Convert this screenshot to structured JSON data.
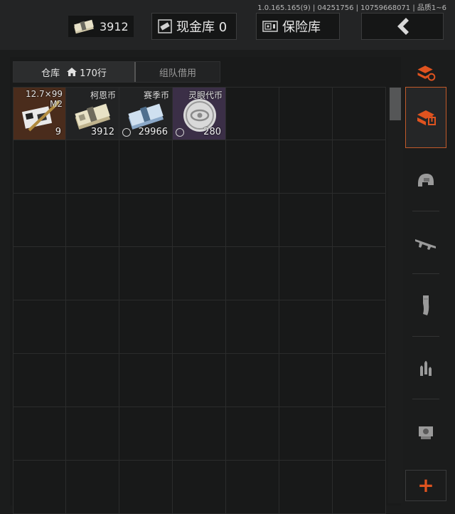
{
  "header": {
    "version": "1.0.165.165(9) | 04251756 | 10759668071 | 品质1~6",
    "money_value": "3912",
    "cash_button_label": "现金库 0",
    "safe_button_label": "保险库"
  },
  "tabs": {
    "warehouse_label": "仓库",
    "rows_label": "170行",
    "team_loan_label": "组队借用"
  },
  "inventory": {
    "items": [
      {
        "name": "12.7×99\nM2",
        "count": "9"
      },
      {
        "name": "柯恩币",
        "count": "3912"
      },
      {
        "name": "赛季币",
        "count": "29966"
      },
      {
        "name": "灵眼代币",
        "count": "280"
      }
    ]
  },
  "sidebar": {
    "icons": [
      "sort-stack-icon",
      "warehouse-download-icon",
      "helmet-icon",
      "rifle-icon",
      "magazine-icon",
      "bullets-icon",
      "scope-icon"
    ],
    "add_symbol": "+"
  },
  "colors": {
    "accent": "#e0531f",
    "ammo_bg": "#4a2c1c",
    "purple_bg": "#3b2f47"
  }
}
